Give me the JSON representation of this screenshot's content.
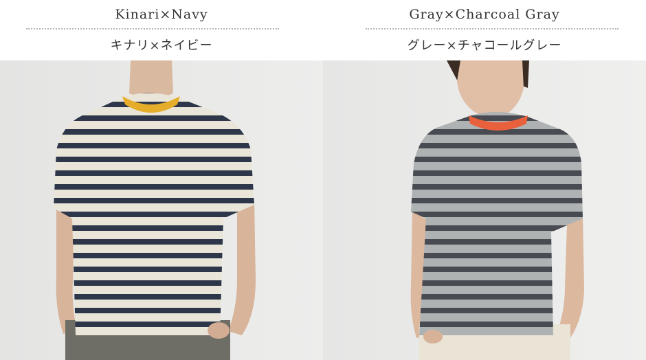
{
  "colors": [
    {
      "name_en": "Kinari×Navy",
      "name_jp": "キナリ×ネイビー",
      "shirt_color": "#f3efe2",
      "stripe_color": "#2f3a4d",
      "collar_color": "#e6ad2a",
      "pants_color": "#6f6e66"
    },
    {
      "name_en": "Gray×Charcoal Gray",
      "name_jp": "グレー×チャコールグレー",
      "shirt_color": "#b9bcbd",
      "stripe_color": "#4c5057",
      "collar_color": "#e8603c",
      "pants_color": "#e9e4d6"
    }
  ]
}
